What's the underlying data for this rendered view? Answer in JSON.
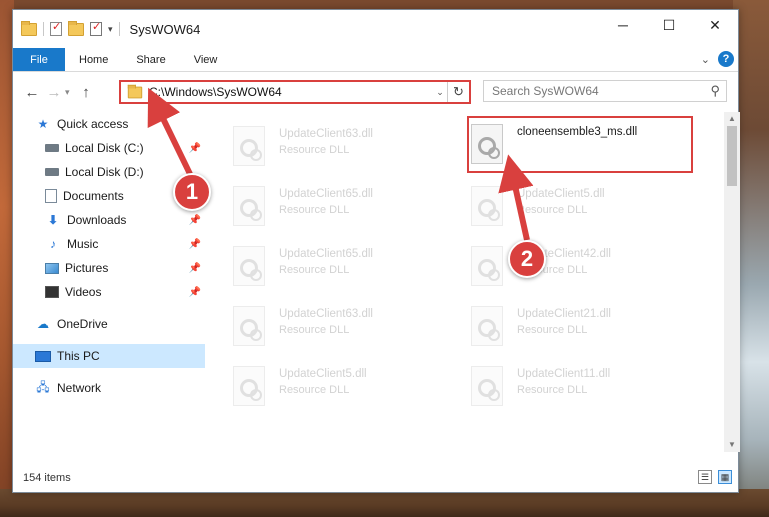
{
  "window": {
    "title": "SysWOW64",
    "controls": {
      "minimize": "─",
      "maximize": "☐",
      "close": "✕"
    }
  },
  "ribbon": {
    "tabs": [
      "File",
      "Home",
      "Share",
      "View"
    ],
    "help": "?"
  },
  "address_bar": {
    "path": "C:\\Windows\\SysWOW64",
    "refresh_icon": "refresh-icon"
  },
  "search": {
    "placeholder": "Search SysWOW64"
  },
  "sidebar": {
    "items": [
      {
        "label": "Quick access",
        "icon": "star-icon"
      },
      {
        "label": "Local Disk (C:)",
        "icon": "disk-icon",
        "pinned": true
      },
      {
        "label": "Local Disk (D:)",
        "icon": "disk-icon"
      },
      {
        "label": "Documents",
        "icon": "documents-icon",
        "pinned": true
      },
      {
        "label": "Downloads",
        "icon": "downloads-icon",
        "pinned": true
      },
      {
        "label": "Music",
        "icon": "music-icon",
        "pinned": true
      },
      {
        "label": "Pictures",
        "icon": "pictures-icon",
        "pinned": true
      },
      {
        "label": "Videos",
        "icon": "videos-icon",
        "pinned": true
      },
      {
        "label": "OneDrive",
        "icon": "onedrive-icon"
      },
      {
        "label": "This PC",
        "icon": "this-pc-icon",
        "selected": true
      },
      {
        "label": "Network",
        "icon": "network-icon"
      }
    ]
  },
  "files": [
    {
      "name": "UpdateClient63.dll",
      "type": "Resource DLL",
      "faded": true
    },
    {
      "name": "cloneensemble3_ms.dll",
      "type": "",
      "faded": false
    },
    {
      "name": "UpdateClient65.dll",
      "type": "Resource DLL",
      "faded": true
    },
    {
      "name": "UpdateClient5.dll",
      "type": "Resource DLL",
      "faded": true
    },
    {
      "name": "UpdateClient65.dll",
      "type": "Resource DLL",
      "faded": true
    },
    {
      "name": "UpdateClient42.dll",
      "type": "Resource DLL",
      "faded": true
    },
    {
      "name": "UpdateClient63.dll",
      "type": "Resource DLL",
      "faded": true
    },
    {
      "name": "UpdateClient21.dll",
      "type": "Resource DLL",
      "faded": true
    },
    {
      "name": "UpdateClient5.dll",
      "type": "Resource DLL",
      "faded": true
    },
    {
      "name": "UpdateClient11.dll",
      "type": "Resource DLL",
      "faded": true
    }
  ],
  "status": {
    "item_count": "154 items"
  },
  "annotations": {
    "step1": "1",
    "step2": "2",
    "accent_color": "#d9403e"
  }
}
